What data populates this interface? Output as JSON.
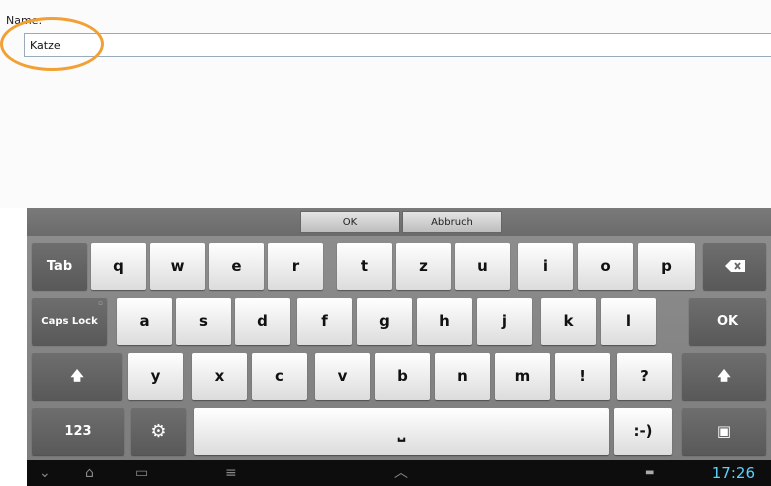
{
  "form": {
    "name_label": "Name:",
    "name_value": "Katze"
  },
  "actions": {
    "ok": "OK",
    "cancel": "Abbruch"
  },
  "keys": {
    "tab": "Tab",
    "caps": "Caps Lock",
    "ok": "OK",
    "num": "123",
    "smiley": ":-)",
    "row1": [
      "q",
      "w",
      "e",
      "r",
      "t",
      "z",
      "u",
      "i",
      "o",
      "p"
    ],
    "row2": [
      "a",
      "s",
      "d",
      "f",
      "g",
      "h",
      "j",
      "k",
      "l"
    ],
    "row3": [
      "y",
      "x",
      "c",
      "v",
      "b",
      "n",
      "m",
      "!",
      "?"
    ],
    "shift_symbol": "🡅",
    "space_symbol": "⎵"
  },
  "status": {
    "time": "17:26"
  },
  "colors": {
    "highlight": "#f2a033",
    "clock": "#5ed0ff"
  }
}
